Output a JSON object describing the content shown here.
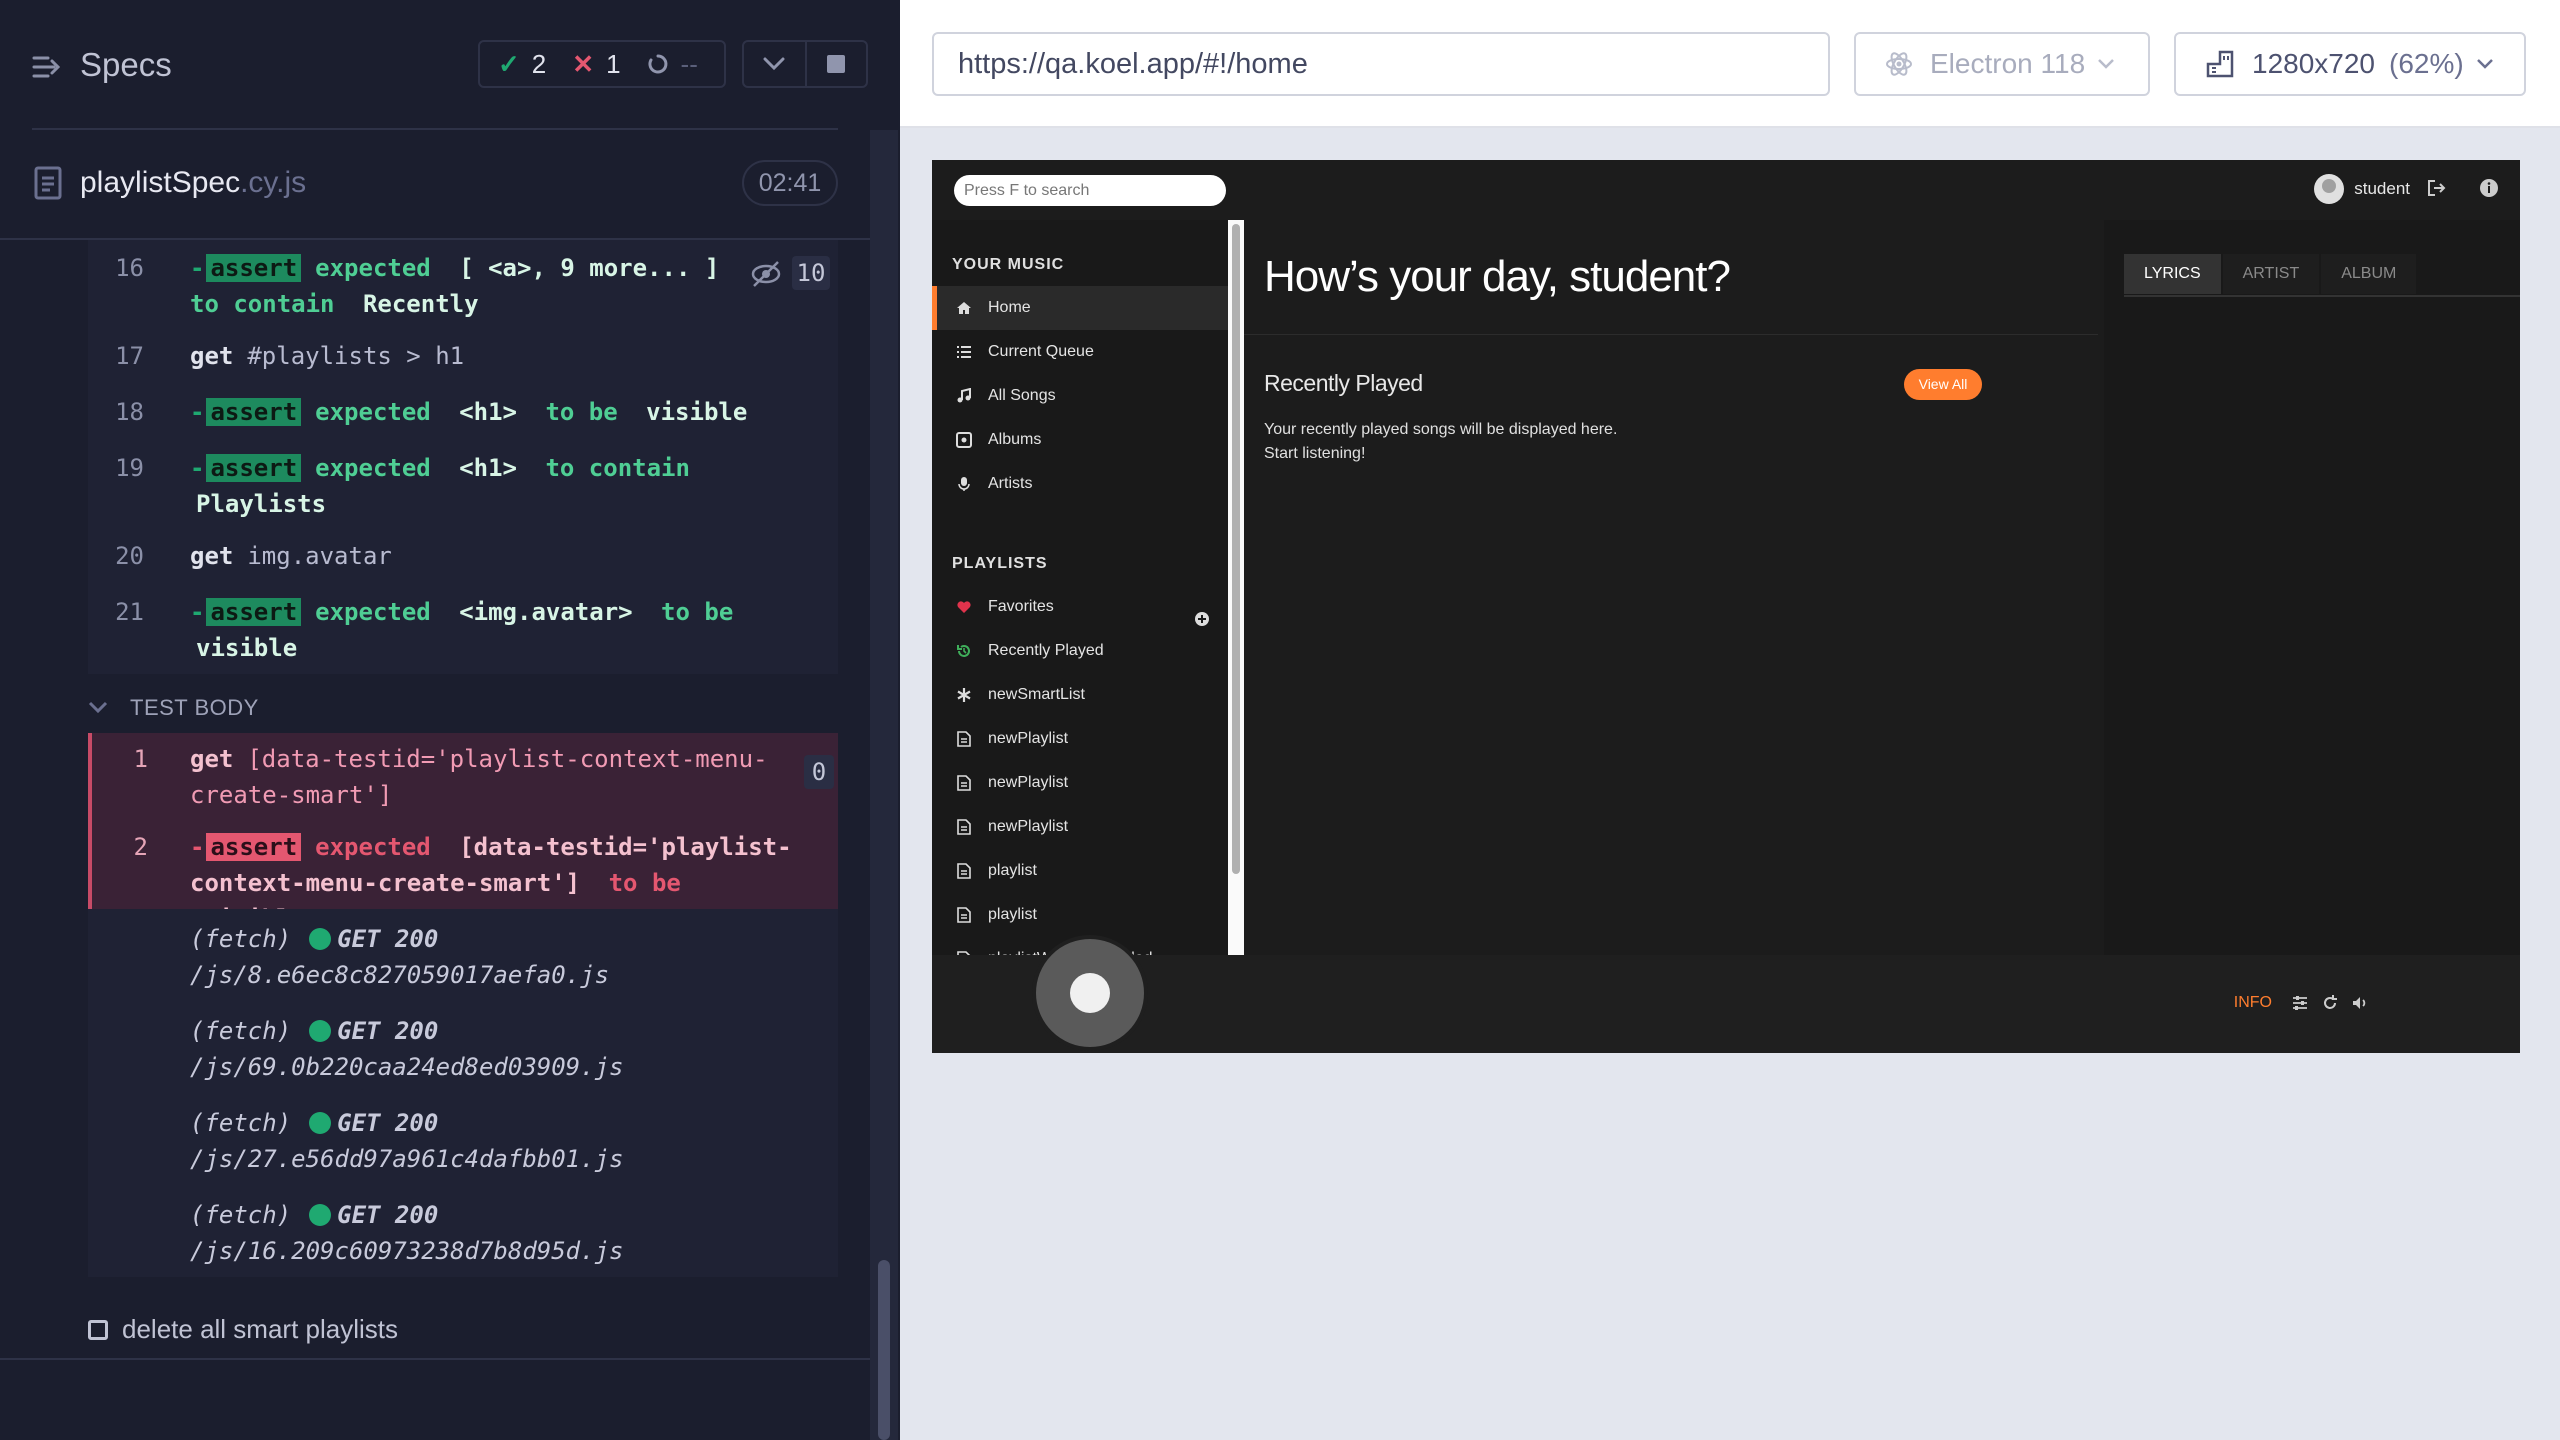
{
  "runner": {
    "title": "Specs",
    "stats": {
      "passed": "2",
      "failed": "1",
      "pending": "--"
    },
    "spec": {
      "name": "playlistSpec",
      "ext": ".cy.js",
      "duration": "02:41"
    },
    "commands": [
      {
        "num": "16",
        "count": "10"
      },
      {
        "num": "17",
        "name": "get",
        "selector": "#playlists > h1"
      },
      {
        "num": "18"
      },
      {
        "num": "19"
      },
      {
        "num": "20",
        "name": "get",
        "selector": "img.avatar"
      },
      {
        "num": "21"
      }
    ],
    "assert_label": "assert",
    "expected_label": "expected",
    "c16": {
      "a": "[ <a>, 9 more... ]",
      "b": "to contain",
      "c": "Recently"
    },
    "c18": {
      "a": "<h1>",
      "b": "to be",
      "c": "visible"
    },
    "c19": {
      "a": "<h1>",
      "b": "to contain",
      "c": "Playlists"
    },
    "c21": {
      "a": "<img.avatar>",
      "b": "to be",
      "c": "visible"
    },
    "section_title": "TEST BODY",
    "failed": {
      "c1": {
        "num": "1",
        "name": "get",
        "selector_line1": "[data-testid='playlist-context-menu-",
        "selector_line2": "create-smart']",
        "count": "0"
      },
      "c2": {
        "num": "2",
        "a_line1": "[data-testid='playlist-",
        "a_line2": "context-menu-create-smart']",
        "b": "to be",
        "c": "visible"
      }
    },
    "fetches": [
      {
        "label": "(fetch)",
        "status": "GET 200",
        "path": "/js/8.e6ec8c827059017aefa0.js"
      },
      {
        "label": "(fetch)",
        "status": "GET 200",
        "path": "/js/69.0b220caa24ed8ed03909.js"
      },
      {
        "label": "(fetch)",
        "status": "GET 200",
        "path": "/js/27.e56dd97a961c4dafbb01.js"
      },
      {
        "label": "(fetch)",
        "status": "GET 200",
        "path": "/js/16.209c60973238d7b8d95d.js"
      }
    ],
    "pending_test": "delete all smart playlists"
  },
  "aut_bar": {
    "url": "https://qa.koel.app/#!/home",
    "browser": "Electron 118",
    "viewport": "1280x720",
    "scale": "(62%)"
  },
  "koel": {
    "search_placeholder": "Press F to search",
    "username": "student",
    "your_music": "YOUR MUSIC",
    "nav": [
      {
        "label": "Home",
        "icon": "home-icon"
      },
      {
        "label": "Current Queue",
        "icon": "list-icon"
      },
      {
        "label": "All Songs",
        "icon": "music-note-icon"
      },
      {
        "label": "Albums",
        "icon": "album-icon"
      },
      {
        "label": "Artists",
        "icon": "microphone-icon"
      }
    ],
    "playlists_title": "PLAYLISTS",
    "playlists": [
      {
        "label": "Favorites",
        "icon": "heart-icon"
      },
      {
        "label": "Recently Played",
        "icon": "history-icon"
      },
      {
        "label": "newSmartList",
        "icon": "asterisk-icon"
      },
      {
        "label": "newPlaylist",
        "icon": "file-icon"
      },
      {
        "label": "newPlaylist",
        "icon": "file-icon"
      },
      {
        "label": "newPlaylist",
        "icon": "file-icon"
      },
      {
        "label": "playlist",
        "icon": "file-icon"
      },
      {
        "label": "playlist",
        "icon": "file-icon"
      },
      {
        "label": "playlistWithSongAdded",
        "icon": "file-icon"
      }
    ],
    "greeting": "How’s your day, student?",
    "recently_played": "Recently Played",
    "view_all": "View All",
    "empty_line1": "Your recently played songs will be displayed here.",
    "empty_line2": "Start listening!",
    "tabs": [
      "LYRICS",
      "ARTIST",
      "ALBUM"
    ],
    "footer_info": "INFO"
  },
  "colors": {
    "accent": "#ff7d2e",
    "pass": "#1fa971",
    "fail": "#e45770"
  }
}
